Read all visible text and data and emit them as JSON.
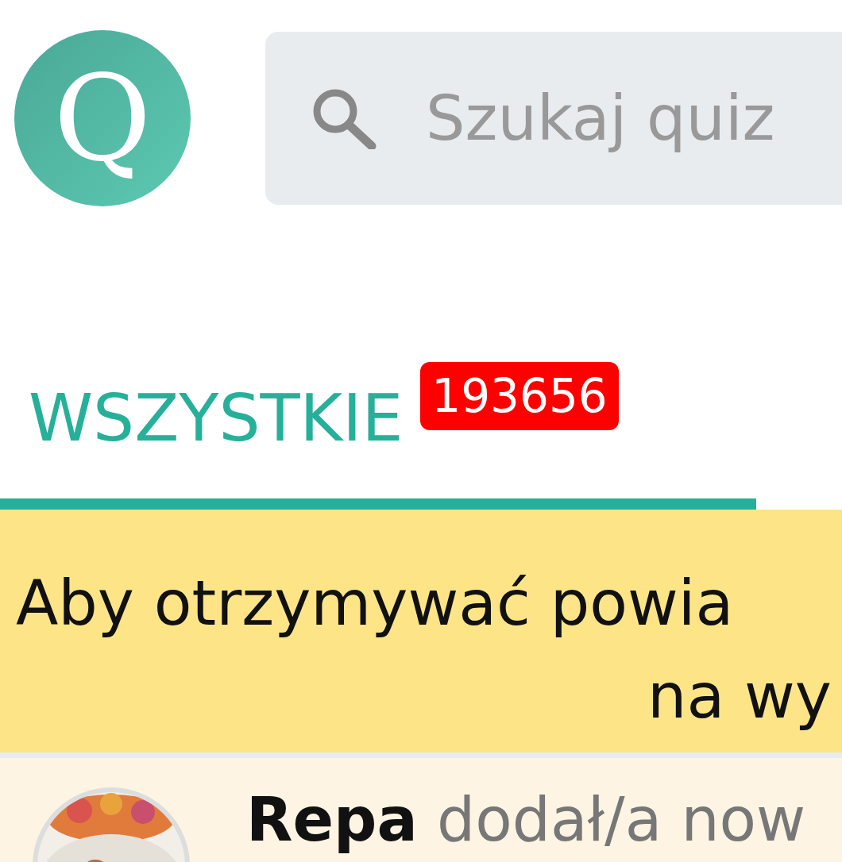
{
  "logo": {
    "text": "Q"
  },
  "search": {
    "placeholder": "Szukaj quiz"
  },
  "tabs": [
    {
      "label": "WSZYSTKIE",
      "badge": "193656",
      "selected": true
    }
  ],
  "banner": {
    "lines": [
      "Aby otrzymywać powia",
      "na wy"
    ]
  },
  "feed": [
    {
      "user": "Repa",
      "action": "dodał/a now"
    }
  ]
}
